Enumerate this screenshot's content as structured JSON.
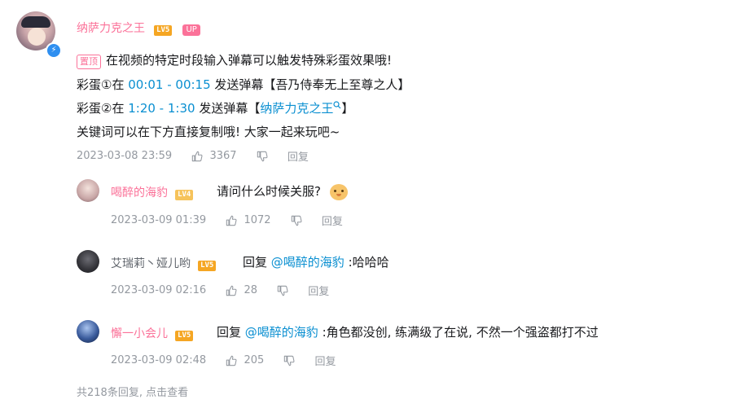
{
  "main_comment": {
    "username": "纳萨力克之王",
    "level": "LV5",
    "up_badge": "UP",
    "pin_tag": "置顶",
    "line1": "在视频的特定时段输入弹幕可以触发特殊彩蛋效果哦!",
    "line2": {
      "prefix": "彩蛋①在 ",
      "t_start": "00:01",
      "dash": " - ",
      "t_end": "00:15",
      "suffix": " 发送弹幕【吾乃侍奉无上至尊之人】"
    },
    "line3": {
      "prefix": "彩蛋②在 ",
      "t_start": "1:20",
      "dash": " - ",
      "t_end": "1:30",
      "mid": " 发送弹幕【",
      "link": "纳萨力克之王",
      "end": "】"
    },
    "line4": "关键词可以在下方直接复制哦! 大家一起来玩吧~",
    "date": "2023-03-08 23:59",
    "likes": "3367",
    "reply_label": "回复"
  },
  "replies": [
    {
      "username": "喝醉的海豹",
      "level": "LV4",
      "text": "请问什么时候关服?",
      "date": "2023-03-09 01:39",
      "likes": "1072",
      "reply_label": "回复"
    },
    {
      "username": "艾瑞莉丶娅儿哟",
      "level": "LV5",
      "prefix": "回复 ",
      "mention": "@喝醉的海豹",
      "text": " :哈哈哈",
      "date": "2023-03-09 02:16",
      "likes": "28",
      "reply_label": "回复"
    },
    {
      "username": "懈一小会儿",
      "level": "LV5",
      "prefix": "回复 ",
      "mention": "@喝醉的海豹",
      "text": " :角色都没创, 练满级了在说, 不然一个强盗都打不过",
      "date": "2023-03-09 02:48",
      "likes": "205",
      "reply_label": "回复"
    }
  ],
  "footer": {
    "summary": "共218条回复, 点击查看"
  },
  "colors": {
    "accent_pink": "#fb7299",
    "link_blue": "#0a8fd1",
    "meta_gray": "#9499a0"
  }
}
